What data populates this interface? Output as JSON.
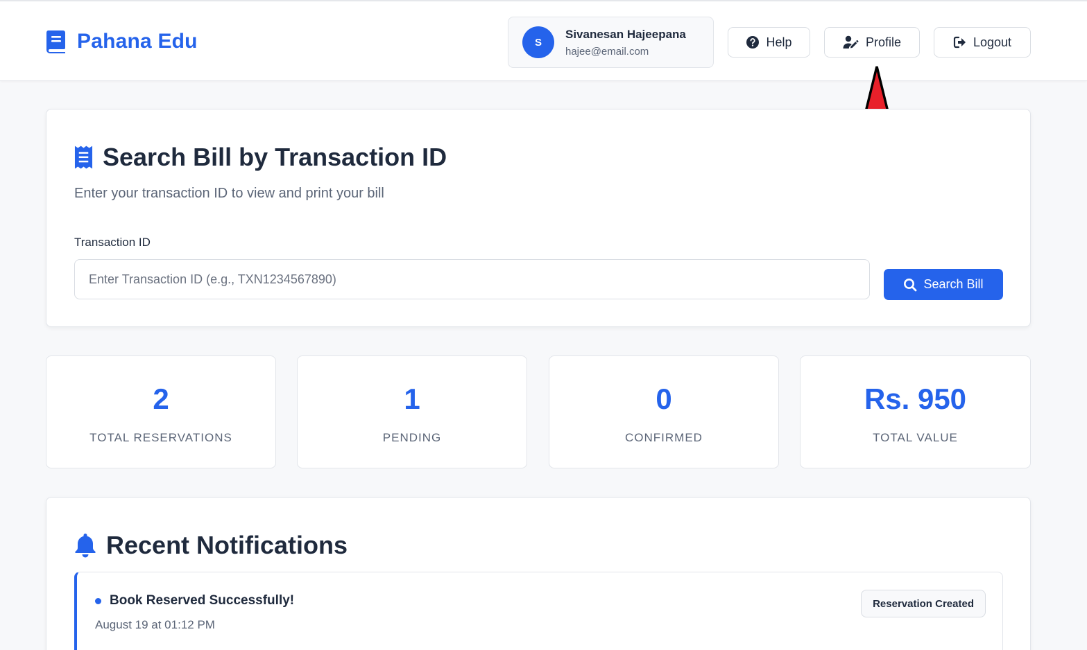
{
  "header": {
    "brand": "Pahana Edu",
    "user": {
      "initial": "S",
      "name": "Sivanesan Hajeepana",
      "email": "hajee@email.com"
    },
    "buttons": {
      "help": "Help",
      "profile": "Profile",
      "logout": "Logout"
    }
  },
  "search": {
    "title": "Search Bill by Transaction ID",
    "subtitle": "Enter your transaction ID to view and print your bill",
    "field_label": "Transaction ID",
    "placeholder": "Enter Transaction ID (e.g., TXN1234567890)",
    "value": "",
    "button": "Search Bill"
  },
  "stats": [
    {
      "value": "2",
      "label": "TOTAL RESERVATIONS"
    },
    {
      "value": "1",
      "label": "PENDING"
    },
    {
      "value": "0",
      "label": "CONFIRMED"
    },
    {
      "value": "Rs. 950",
      "label": "TOTAL VALUE"
    }
  ],
  "notifications": {
    "title": "Recent Notifications",
    "items": [
      {
        "text": "Book Reserved Successfully!",
        "time": "August 19 at 01:12 PM",
        "badge": "Reservation Created"
      }
    ]
  },
  "colors": {
    "accent": "#2563eb",
    "annotation_arrow": "#e8202a"
  },
  "icons": {
    "brand": "book-icon",
    "help": "question-circle-icon",
    "profile": "user-edit-icon",
    "logout": "sign-out-icon",
    "search_card": "receipt-icon",
    "search_button": "search-icon",
    "notifications": "bell-icon"
  }
}
